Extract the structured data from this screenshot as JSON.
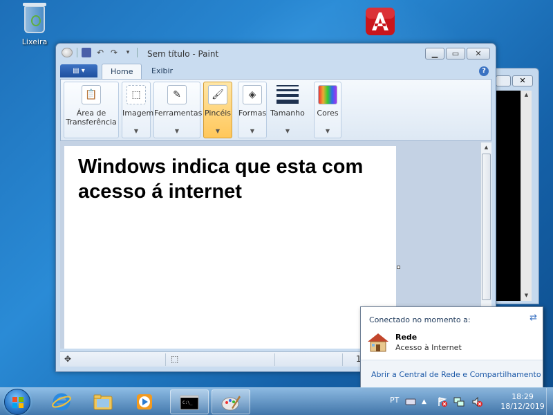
{
  "desktop": {
    "recycle_bin_label": "Lixeira"
  },
  "paint": {
    "title": "Sem título - Paint",
    "tabs": [
      "Home",
      "Exibir"
    ],
    "groups": {
      "clipboard": "Área de Transferência",
      "image": "Imagem",
      "tools": "Ferramentas",
      "brushes": "Pincéis",
      "shapes": "Formas",
      "size": "Tamanho",
      "colors": "Cores"
    },
    "canvas_text_line1": "Windows indica que esta com",
    "canvas_text_line2": "acesso á internet",
    "status_zoom": "1"
  },
  "network_popup": {
    "header": "Conectado no momento a:",
    "network_name": "Rede",
    "network_status": "Acesso à Internet",
    "footer_link": "Abrir a Central de Rede e Compartilhamento"
  },
  "taskbar": {
    "language": "PT",
    "time": "18:29",
    "date": "18/12/2019"
  },
  "colors": {
    "accent": "#3a72c2",
    "selected_group": "#ffc75a"
  }
}
